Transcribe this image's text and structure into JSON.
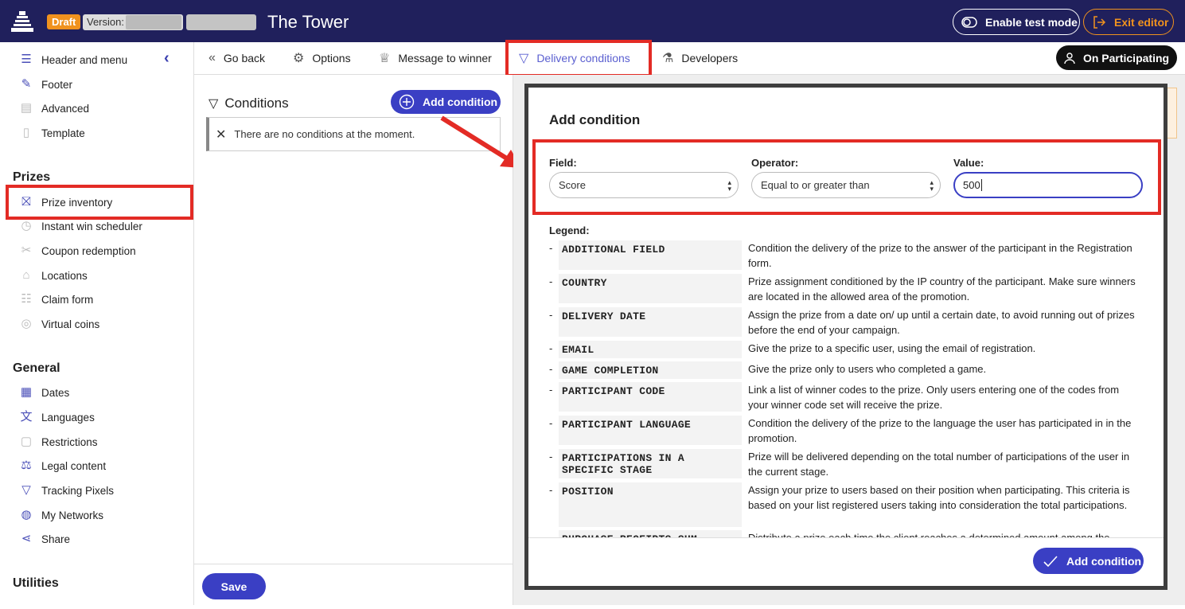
{
  "header": {
    "draft_label": "Draft",
    "version_label": "Version:",
    "title": "The Tower",
    "test_mode_label": "Enable test mode",
    "exit_label": "Exit editor"
  },
  "sidebar": {
    "top_items": [
      {
        "label": "Header and menu",
        "icon": "menu-icon"
      },
      {
        "label": "Footer",
        "icon": "footer-icon"
      },
      {
        "label": "Advanced",
        "icon": "advanced-icon"
      },
      {
        "label": "Template",
        "icon": "template-icon"
      }
    ],
    "prizes_heading": "Prizes",
    "prizes_items": [
      {
        "label": "Prize inventory",
        "icon": "gift-icon"
      },
      {
        "label": "Instant win scheduler",
        "icon": "clock-icon"
      },
      {
        "label": "Coupon redemption",
        "icon": "coupon-icon"
      },
      {
        "label": "Locations",
        "icon": "store-icon"
      },
      {
        "label": "Claim form",
        "icon": "form-icon"
      },
      {
        "label": "Virtual coins",
        "icon": "coins-icon"
      }
    ],
    "general_heading": "General",
    "general_items": [
      {
        "label": "Dates",
        "icon": "calendar-icon"
      },
      {
        "label": "Languages",
        "icon": "translate-icon"
      },
      {
        "label": "Restrictions",
        "icon": "lock-icon"
      },
      {
        "label": "Legal content",
        "icon": "gavel-icon"
      },
      {
        "label": "Tracking Pixels",
        "icon": "funnel-icon"
      },
      {
        "label": "My Networks",
        "icon": "globe-icon"
      },
      {
        "label": "Share",
        "icon": "share-icon"
      }
    ],
    "utilities_heading": "Utilities"
  },
  "nav": {
    "go_back": "Go back",
    "options": "Options",
    "message_to_winner": "Message to winner",
    "delivery_conditions": "Delivery conditions",
    "developers": "Developers",
    "on_participating": "On Participating"
  },
  "conditions": {
    "title": "Conditions",
    "add_label": "Add condition",
    "empty_message": "There are no conditions at the moment.",
    "save_label": "Save"
  },
  "modal": {
    "title": "Add condition",
    "field_label": "Field:",
    "field_value": "Score",
    "operator_label": "Operator:",
    "operator_value": "Equal to or greater than",
    "value_label": "Value:",
    "value_value": "500",
    "legend_label": "Legend:",
    "legend": [
      {
        "key": "ADDITIONAL FIELD",
        "desc": "Condition the delivery of the prize to the answer of the participant in the Registration form."
      },
      {
        "key": "COUNTRY",
        "desc": "Prize assignment conditioned by the IP country of the participant. Make sure winners are located in the allowed area of the promotion."
      },
      {
        "key": "DELIVERY DATE",
        "desc": "Assign the prize from a date on/ up until a certain date, to avoid running out of prizes before the end of your campaign."
      },
      {
        "key": "EMAIL",
        "desc": "Give the prize to a specific user, using the email of registration."
      },
      {
        "key": "GAME COMPLETION",
        "desc": "Give the prize only to users who completed a game."
      },
      {
        "key": "PARTICIPANT CODE",
        "desc": "Link a list of winner codes to the prize. Only users entering one of the codes from your winner code set will receive the prize."
      },
      {
        "key": "PARTICIPANT LANGUAGE",
        "desc": "Condition the delivery of the prize to the language the user has participated in in the promotion."
      },
      {
        "key": "PARTICIPATIONS IN A SPECIFIC STAGE",
        "desc": "Prize will be delivered depending on the total number of participations of the user in the current stage."
      },
      {
        "key": "POSITION",
        "desc": "Assign your prize to users based on their position when participating. This criteria is based on your list registered users taking into consideration the total participations."
      },
      {
        "key": "PURCHASE RECEIPTS SUM",
        "desc": "Distribute a prize each time the client reaches a determined amount among the"
      }
    ],
    "submit_label": "Add condition"
  },
  "colors": {
    "header_bg": "#20205c",
    "accent": "#3a3fc4",
    "highlight": "#e32b25",
    "draft": "#f0921e"
  }
}
